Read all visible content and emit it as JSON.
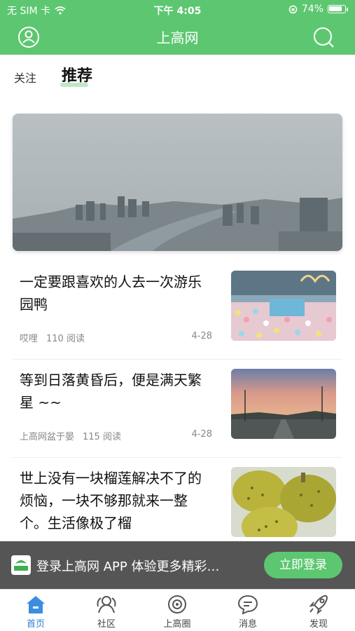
{
  "status_bar": {
    "carrier": "无 SIM 卡",
    "time": "下午 4:05",
    "battery": "74%"
  },
  "header": {
    "title": "上高网"
  },
  "feed_tabs": {
    "follow": "关注",
    "recommend": "推荐"
  },
  "articles": [
    {
      "title": "一定要跟喜欢的人去一次游乐园鸭",
      "author": "哎哩",
      "reads": "110 阅读",
      "date": "4-28"
    },
    {
      "title": "等到日落黄昏后，便是满天繁星 ~~",
      "author": "上高网盆于晏",
      "reads": "115 阅读",
      "date": "4-28"
    },
    {
      "title": "世上没有一块榴莲解决不了的烦恼，一块不够那就来一整个。生活像极了榴",
      "author": "",
      "reads": "",
      "date": ""
    }
  ],
  "login_prompt": {
    "text": "登录上高网 APP 体验更多精彩…",
    "button": "立即登录"
  },
  "tab_bar": {
    "items": [
      "首页",
      "社区",
      "上高圈",
      "消息",
      "发现"
    ]
  },
  "colors": {
    "brand_green": "#5cc770",
    "active_tab_blue": "#2f7fd6"
  }
}
